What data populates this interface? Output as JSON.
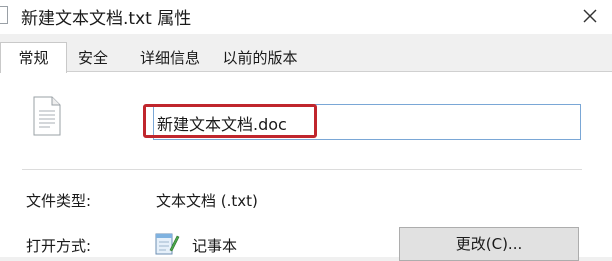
{
  "window": {
    "title": "新建文本文档.txt 属性",
    "close_icon": "close-icon"
  },
  "tabs": [
    {
      "label": "常规",
      "active": true
    },
    {
      "label": "安全",
      "active": false
    },
    {
      "label": "详细信息",
      "active": false
    },
    {
      "label": "以前的版本",
      "active": false
    }
  ],
  "general": {
    "file_icon": "text-file-icon",
    "filename_value": "新建文本文档.doc",
    "highlight_color": "#c0262d",
    "file_type_label": "文件类型:",
    "file_type_value": "文本文档 (.txt)",
    "open_with_label": "打开方式:",
    "open_with_icon": "notepad-icon",
    "open_with_value": "记事本",
    "change_button_label": "更改(C)..."
  }
}
